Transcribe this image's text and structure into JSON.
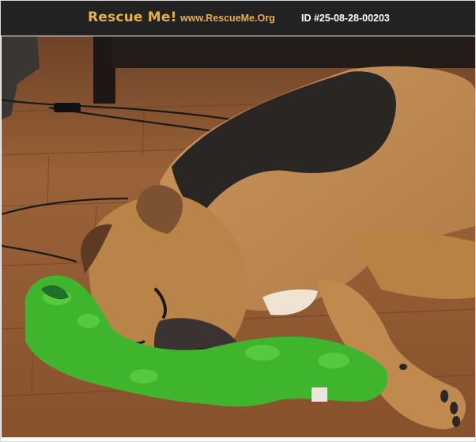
{
  "header": {
    "brand": "Rescue Me!",
    "site": "www.RescueMe.Org",
    "listing_id": "ID #25-08-28-00203"
  },
  "photo": {
    "subject": "sleeping-dog-with-green-toy"
  },
  "colors": {
    "header_bg": "#222222",
    "brand": "#e8b04a",
    "id_text": "#ffffff",
    "floor": "#8e5a35",
    "toy": "#3fb52d"
  }
}
